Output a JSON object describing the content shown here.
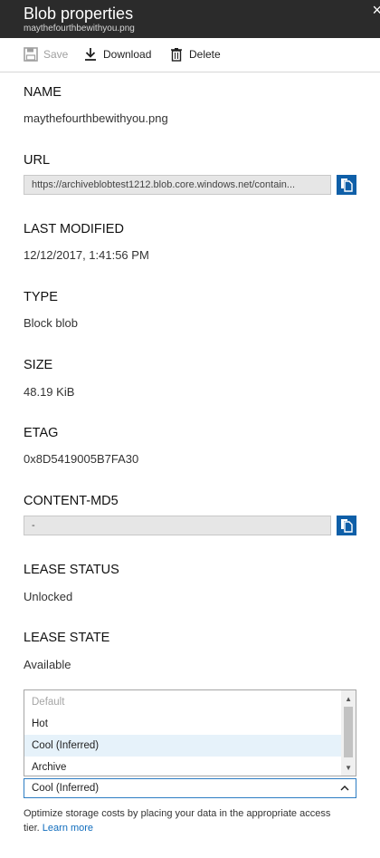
{
  "header": {
    "title": "Blob properties",
    "subtitle": "maythefourthbewithyou.png",
    "close_glyph": "×"
  },
  "toolbar": {
    "save_label": "Save",
    "download_label": "Download",
    "delete_label": "Delete"
  },
  "properties": {
    "name": {
      "label": "NAME",
      "value": "maythefourthbewithyou.png"
    },
    "url": {
      "label": "URL",
      "value": "https://archiveblobtest1212.blob.core.windows.net/contain..."
    },
    "last_modified": {
      "label": "LAST MODIFIED",
      "value": "12/12/2017, 1:41:56 PM"
    },
    "type": {
      "label": "TYPE",
      "value": "Block blob"
    },
    "size": {
      "label": "SIZE",
      "value": "48.19 KiB"
    },
    "etag": {
      "label": "ETAG",
      "value": "0x8D5419005B7FA30"
    },
    "content_md5": {
      "label": "CONTENT-MD5",
      "value": "-"
    },
    "lease_status": {
      "label": "LEASE STATUS",
      "value": "Unlocked"
    },
    "lease_state": {
      "label": "LEASE STATE",
      "value": "Available"
    }
  },
  "access_tier": {
    "options": [
      "Default",
      "Hot",
      "Cool (Inferred)",
      "Archive"
    ],
    "selected": "Cool (Inferred)",
    "help_text": "Optimize storage costs by placing your data in the appropriate access tier.",
    "learn_more": "Learn more"
  },
  "colors": {
    "header_bg": "#2b2b2b",
    "accent": "#0f5fa8",
    "selected_bg": "#e6f2fa"
  },
  "icons": [
    "save-icon",
    "download-icon",
    "delete-icon",
    "copy-icon",
    "chevron-up-icon",
    "close-icon"
  ]
}
